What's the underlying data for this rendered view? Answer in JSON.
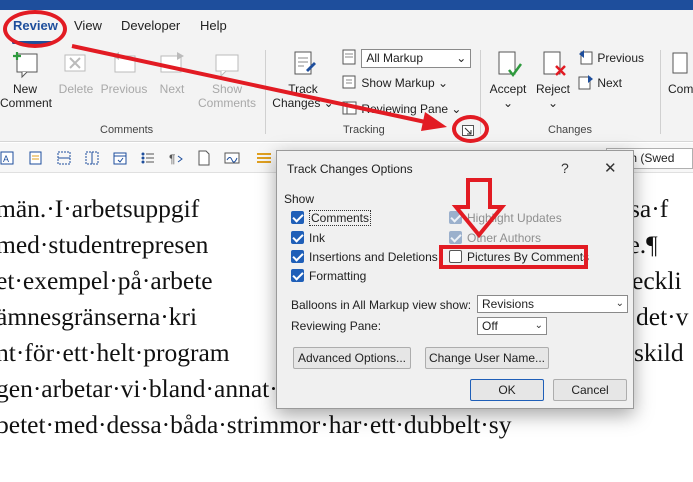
{
  "tabs": [
    {
      "label": "Review",
      "active": true
    },
    {
      "label": "View",
      "active": false
    },
    {
      "label": "Developer",
      "active": false
    },
    {
      "label": "Help",
      "active": false
    }
  ],
  "ribbon": {
    "comments_group": {
      "label": "Comments",
      "new_comment": "New\nComment",
      "new_comment_l1": "New",
      "new_comment_l2": "Comment",
      "delete": "Delete",
      "previous": "Previous",
      "next": "Next",
      "show_comments_l1": "Show",
      "show_comments_l2": "Comments"
    },
    "tracking_group": {
      "label": "Tracking",
      "track_changes_l1": "Track",
      "track_changes_l2": "Changes",
      "markup_select": "All Markup",
      "show_markup": "Show Markup",
      "reviewing_pane": "Reviewing Pane"
    },
    "changes_group": {
      "label": "Changes",
      "accept": "Accept",
      "reject": "Reject",
      "previous": "Previous",
      "next": "Next",
      "compare_partial": "Com"
    }
  },
  "toolbar2": {
    "language": "dish (Swed"
  },
  "document": {
    "lines": [
      "män.·I·arbetsuppgif",
      "med·studentrepresen",
      "et·exempel·på·arbete",
      "ämnesgränserna·kri",
      "nt·för·ett·helt·program",
      "gen·arbetar·vi·bland·annat·med·strimmorna·didak",
      "betet·med·dessa·båda·strimmor·har·ett·dubbelt·sy"
    ],
    "right_fragments": [
      "dessa·f",
      "re.¶",
      "eckli",
      "det·v",
      "skild"
    ]
  },
  "dialog": {
    "title": "Track Changes Options",
    "help": "?",
    "close": "✕",
    "show_section": "Show",
    "checkboxes_left": [
      {
        "label": "Comments",
        "checked": true
      },
      {
        "label": "Ink",
        "checked": true
      },
      {
        "label": "Insertions and Deletions",
        "checked": true
      },
      {
        "label": "Formatting",
        "checked": true
      }
    ],
    "checkboxes_right": [
      {
        "label": "Highlight Updates",
        "checked": true,
        "disabled": true
      },
      {
        "label": "Other Authors",
        "checked": true,
        "disabled": true
      },
      {
        "label": "Pictures By Comments",
        "checked": false,
        "disabled": false
      }
    ],
    "balloons_label": "Balloons in All Markup view show:",
    "balloons_value": "Revisions",
    "reviewing_pane_label": "Reviewing Pane:",
    "reviewing_pane_value": "Off",
    "advanced_button": "Advanced Options...",
    "change_user_button": "Change User Name...",
    "ok_button": "OK",
    "cancel_button": "Cancel"
  },
  "colors": {
    "accent": "#1e4e9c",
    "annotation_red": "#e21b23",
    "checkbox_blue": "#1f5fb8"
  }
}
